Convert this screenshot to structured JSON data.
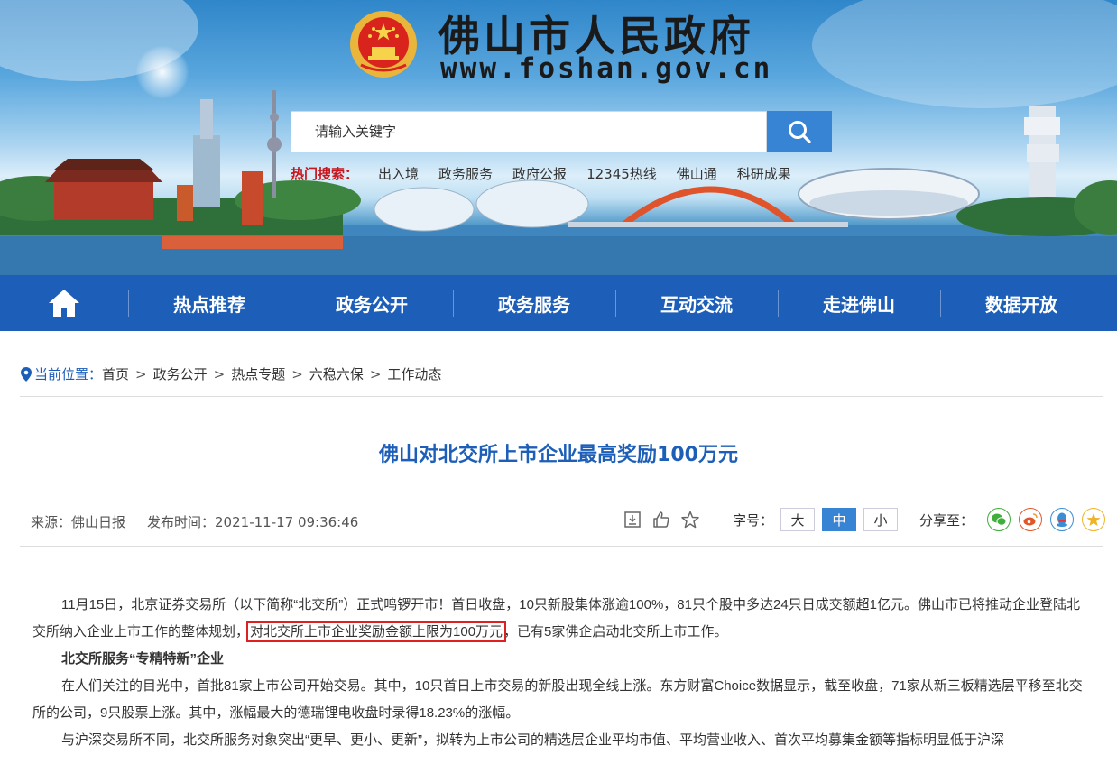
{
  "header": {
    "site_title": "佛山市人民政府",
    "site_url": "www.foshan.gov.cn",
    "emblem_icon": "national-emblem-icon"
  },
  "search": {
    "placeholder": "请输入关键字",
    "button_icon": "search-icon"
  },
  "hot_search": {
    "label": "热门搜索：",
    "items": [
      "出入境",
      "政务服务",
      "政府公报",
      "12345热线",
      "佛山通",
      "科研成果"
    ]
  },
  "nav": {
    "home_icon": "home-icon",
    "items": [
      "热点推荐",
      "政务公开",
      "政务服务",
      "互动交流",
      "走进佛山",
      "数据开放"
    ]
  },
  "breadcrumb": {
    "label": "当前位置：",
    "items": [
      "首页",
      "政务公开",
      "热点专题",
      "六稳六保",
      "工作动态"
    ],
    "separator": ">"
  },
  "article": {
    "title": "佛山对北交所上市企业最高奖励100万元",
    "source": "来源：佛山日报",
    "publish_time": "发布时间：2021-11-17 09:36:46",
    "font_size_label": "字号：",
    "font_sizes": [
      "大",
      "中",
      "小"
    ],
    "font_size_active": "中",
    "share_label": "分享至：",
    "share_targets": [
      "wechat",
      "weibo",
      "qq",
      "qzone"
    ],
    "p1_before": "11月15日，北京证券交易所（以下简称“北交所”）正式鸣锣开市！首日收盘，10只新股集体涨逾100%，81只个股中多达24只日成交额超1亿元。佛山市已将推动企业登陆北交所纳入企业上市工作的整体规划，",
    "p1_highlight": "对北交所上市企业奖励金额上限为100万元",
    "p1_after": "，已有5家佛企启动北交所上市工作。",
    "subheading": "北交所服务“专精特新”企业",
    "p2": "在人们关注的目光中，首批81家上市公司开始交易。其中，10只首日上市交易的新股出现全线上涨。东方财富Choice数据显示，截至收盘，71家从新三板精选层平移至北交所的公司，9只股票上涨。其中，涨幅最大的德瑞锂电收盘时录得18.23%的涨幅。",
    "p3": "与沪深交易所不同，北交所服务对象突出“更早、更小、更新”，拟转为上市公司的精选层企业平均市值、平均营业收入、首次平均募集金额等指标明显低于沪深"
  },
  "colors": {
    "nav_bg": "#1d5fb8",
    "title_blue": "#1d5fb8",
    "search_btn": "#3783d4",
    "hot_red": "#c8161d",
    "highlight_border": "#e02020"
  }
}
